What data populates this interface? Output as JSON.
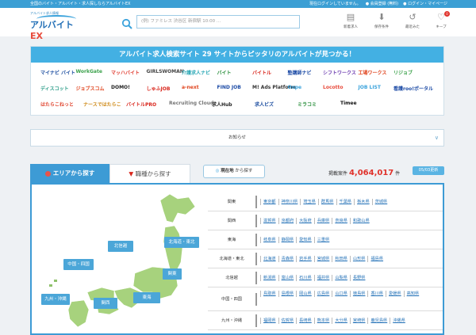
{
  "topbar": {
    "tagline": "全国のバイト・アルバイト・求人探しならアルバイトEX",
    "status": "現在ログインしていません。",
    "register": "会員登録 (無料)",
    "login": "ログイン・マイページ"
  },
  "logo": {
    "tag": "アルバイト求人情報",
    "main": "アルバイト",
    "ex": "EX"
  },
  "search": {
    "placeholder": "(例) ファミレス 渋谷区 新宿駅 10:00 ..."
  },
  "header_icons": [
    {
      "label": "新着求人",
      "glyph": "▤"
    },
    {
      "label": "保存条件",
      "glyph": "⬇"
    },
    {
      "label": "最近みた",
      "glyph": "↺"
    },
    {
      "label": "キープ",
      "glyph": "♡",
      "badge": "0"
    }
  ],
  "banner": {
    "title": "アルバイト求人検索サイト 29 サイトからピッタリのアルバイトが見つかる！",
    "sites": [
      {
        "t": "マイナビ バイト",
        "c": "#1d4ea0"
      },
      {
        "t": "WorkGate",
        "c": "#3aa14a"
      },
      {
        "t": "マッハバイト",
        "c": "#e03a2e"
      },
      {
        "t": "GIRLSWOMAN",
        "c": "#444"
      },
      {
        "t": "介護求人ナビ",
        "c": "#2aa8b6"
      },
      {
        "t": "バイト",
        "c": "#2a8f3c"
      },
      {
        "t": "バイトル",
        "c": "#d9261c"
      },
      {
        "t": "塾講師ナビ",
        "c": "#1b4aa5"
      },
      {
        "t": "シフトワークス",
        "c": "#6d3db0"
      },
      {
        "t": "工場ワークス",
        "c": "#e0451f"
      },
      {
        "t": "リジョブ",
        "c": "#3aa14a"
      },
      {
        "t": "ディスコット",
        "c": "#2f9e8a"
      },
      {
        "t": "ジョブスコム",
        "c": "#e0451f"
      },
      {
        "t": "DOMO!",
        "c": "#222"
      },
      {
        "t": "しゅふJOB",
        "c": "#d9261c"
      },
      {
        "t": "a-next",
        "c": "#e0451f"
      },
      {
        "t": "FIND JOB",
        "c": "#1b4aa5"
      },
      {
        "t": "M! Ads Platform",
        "c": "#333"
      },
      {
        "t": "Oope",
        "c": "#3ba3dc"
      },
      {
        "t": "Locotto",
        "c": "#e84b3c"
      },
      {
        "t": "JOB LIST",
        "c": "#3ba3dc"
      },
      {
        "t": "看護roo!ポータル",
        "c": "#1b4aa5"
      },
      {
        "t": "はたらこねっと",
        "c": "#e0452f"
      },
      {
        "t": "ナースではたらこ",
        "c": "#cf8a18"
      },
      {
        "t": "バイトルPRO",
        "c": "#d9261c"
      },
      {
        "t": "Recruiting Cloud",
        "c": "#777"
      },
      {
        "t": "求人Hub",
        "c": "#222"
      },
      {
        "t": "求人ビズ",
        "c": "#1d4ea0"
      },
      {
        "t": "ミラコミ",
        "c": "#2a8f3c"
      },
      {
        "t": "Timee",
        "c": "#111"
      }
    ]
  },
  "notice": {
    "label": "お知らせ"
  },
  "tabs": {
    "area": "エリアから探す",
    "job": "職種から探す"
  },
  "location": {
    "label": "現在地",
    "suffix": "から探す"
  },
  "count": {
    "label": "掲載案件",
    "value": "4,064,017",
    "unit": "件",
    "updated": "05/03更新"
  },
  "map_labels": [
    "北信越",
    "北海道・東北",
    "中国・四国",
    "関東",
    "九州・沖縄",
    "関西",
    "東海"
  ],
  "regions": [
    {
      "name": "関東",
      "prefs": [
        "東京都",
        "神奈川県",
        "埼玉県",
        "群馬県",
        "千葉県",
        "栃木県",
        "茨城県"
      ]
    },
    {
      "name": "関西",
      "prefs": [
        "滋賀県",
        "京都府",
        "大阪府",
        "兵庫県",
        "奈良県",
        "和歌山県"
      ]
    },
    {
      "name": "東海",
      "prefs": [
        "岐阜県",
        "静岡県",
        "愛知県",
        "三重県"
      ]
    },
    {
      "name": "北海道・東北",
      "prefs": [
        "北海道",
        "青森県",
        "岩手県",
        "宮城県",
        "秋田県",
        "山形県",
        "福島県"
      ]
    },
    {
      "name": "北信越",
      "prefs": [
        "新潟県",
        "富山県",
        "石川県",
        "福井県",
        "山梨県",
        "長野県"
      ]
    },
    {
      "name": "中国・四国",
      "prefs": [
        "鳥取県",
        "島根県",
        "岡山県",
        "広島県",
        "山口県",
        "徳島県",
        "香川県",
        "愛媛県",
        "高知県"
      ]
    },
    {
      "name": "九州・沖縄",
      "prefs": [
        "福岡県",
        "佐賀県",
        "長崎県",
        "熊本県",
        "大分県",
        "宮崎県",
        "鹿児島県",
        "沖縄県"
      ]
    }
  ]
}
